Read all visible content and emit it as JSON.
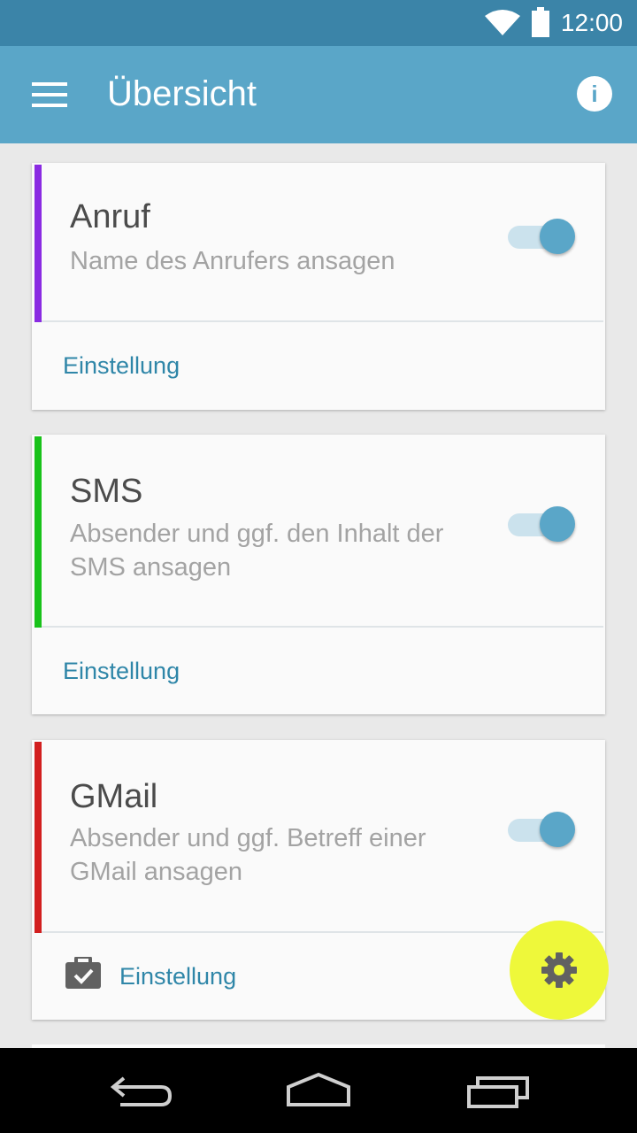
{
  "status": {
    "time": "12:00"
  },
  "appbar": {
    "title": "Übersicht"
  },
  "cards": [
    {
      "title": "Anruf",
      "description": "Name des Anrufers ansagen",
      "action": "Einstellung",
      "enabled": true,
      "color": "#8a2be2"
    },
    {
      "title": "SMS",
      "description": "Absender und ggf. den Inhalt der SMS ansagen",
      "action": "Einstellung",
      "enabled": true,
      "color": "#19c21a"
    },
    {
      "title": "GMail",
      "description": "Absender und ggf. Betreff einer GMail ansagen",
      "action": "Einstellung",
      "enabled": true,
      "color": "#d21f1f"
    }
  ],
  "colors": {
    "primary": "#5aa6c8",
    "status_bar": "#3b84a8",
    "fab": "#eef83a",
    "link": "#2f86a8"
  }
}
